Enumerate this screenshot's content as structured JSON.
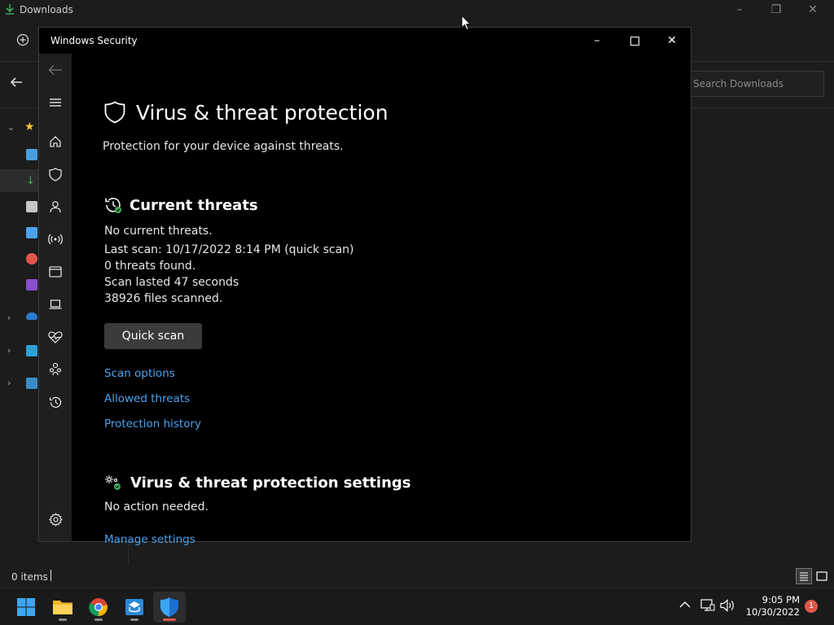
{
  "explorer": {
    "title": "Downloads",
    "search_placeholder": "Search Downloads",
    "status_items": "0 items"
  },
  "security": {
    "window_title": "Windows Security",
    "page_title": "Virus & threat protection",
    "page_subtitle": "Protection for your device against threats.",
    "current_threats": {
      "heading": "Current threats",
      "lines": [
        "No current threats.",
        "Last scan: 10/17/2022 8:14 PM (quick scan)",
        "0 threats found.",
        "Scan lasted 47 seconds",
        "38926 files scanned."
      ],
      "quick_scan_label": "Quick scan",
      "links": [
        "Scan options",
        "Allowed threats",
        "Protection history"
      ]
    },
    "settings_section": {
      "heading": "Virus & threat protection settings",
      "status": "No action needed.",
      "link": "Manage settings"
    }
  },
  "taskbar": {
    "time": "9:05 PM",
    "date": "10/30/2022",
    "notification_count": "1"
  },
  "colors": {
    "accent_link": "#4aa3f0",
    "ok_green": "#3fae5a",
    "notification_red": "#e0574a"
  }
}
